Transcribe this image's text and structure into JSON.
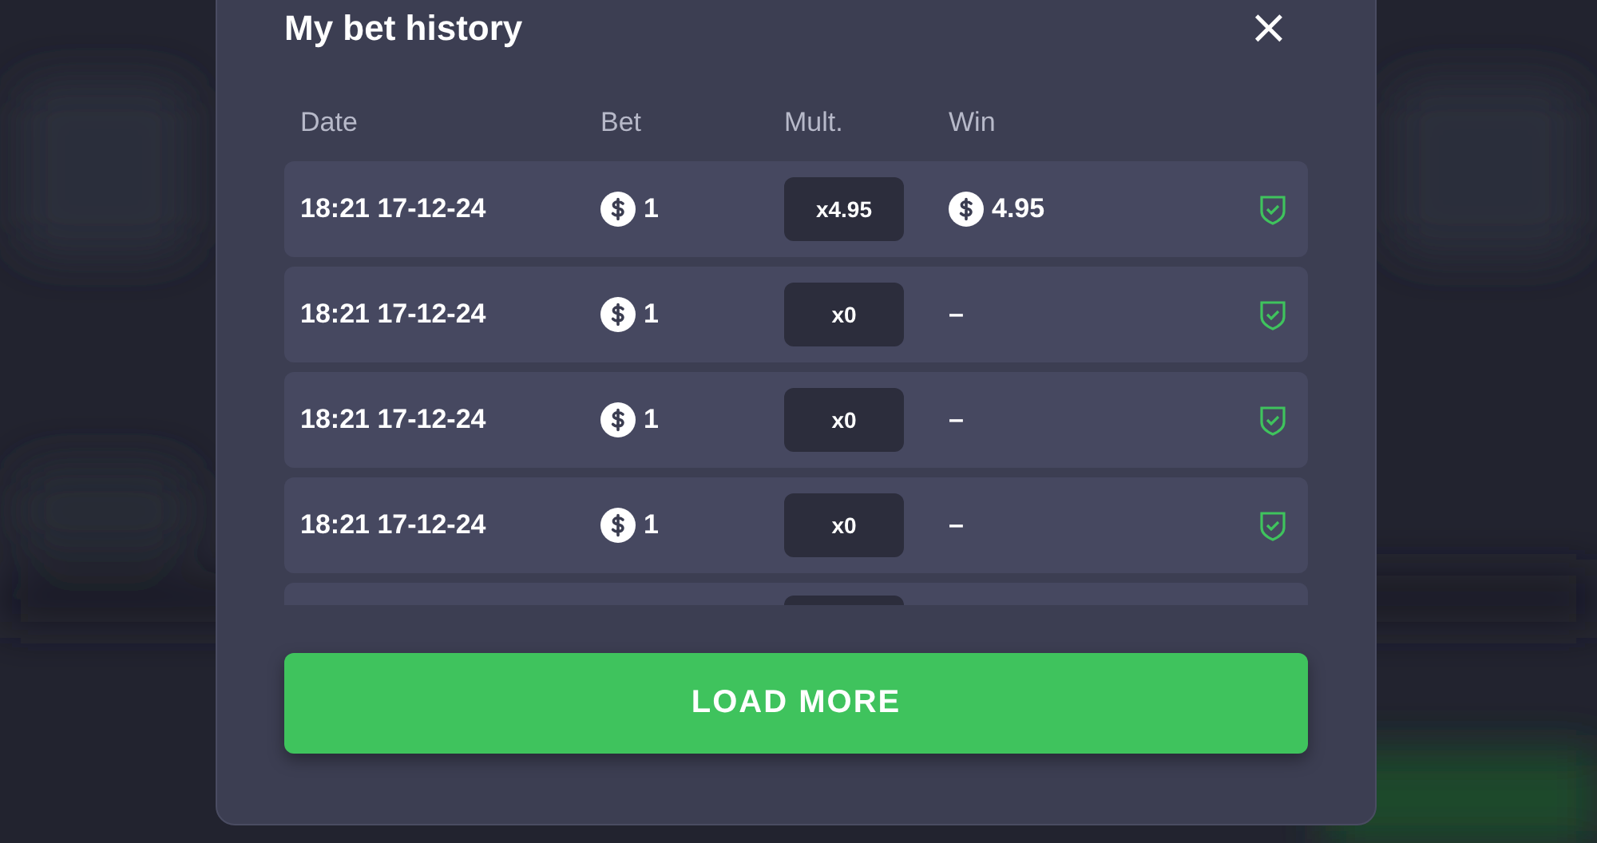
{
  "modal": {
    "title": "My bet history",
    "close": "×"
  },
  "columns": [
    "Date",
    "Bet",
    "Mult.",
    "Win"
  ],
  "rows": [
    {
      "date": "18:21 17-12-24",
      "bet": "1",
      "mult": "x4.95",
      "win": "4.95",
      "win_coin": true,
      "verified": true
    },
    {
      "date": "18:21 17-12-24",
      "bet": "1",
      "mult": "x0",
      "win": "–",
      "win_coin": false,
      "verified": true
    },
    {
      "date": "18:21 17-12-24",
      "bet": "1",
      "mult": "x0",
      "win": "–",
      "win_coin": false,
      "verified": true
    },
    {
      "date": "18:21 17-12-24",
      "bet": "1",
      "mult": "x0",
      "win": "–",
      "win_coin": false,
      "verified": true
    }
  ],
  "load_more": "LOAD MORE"
}
